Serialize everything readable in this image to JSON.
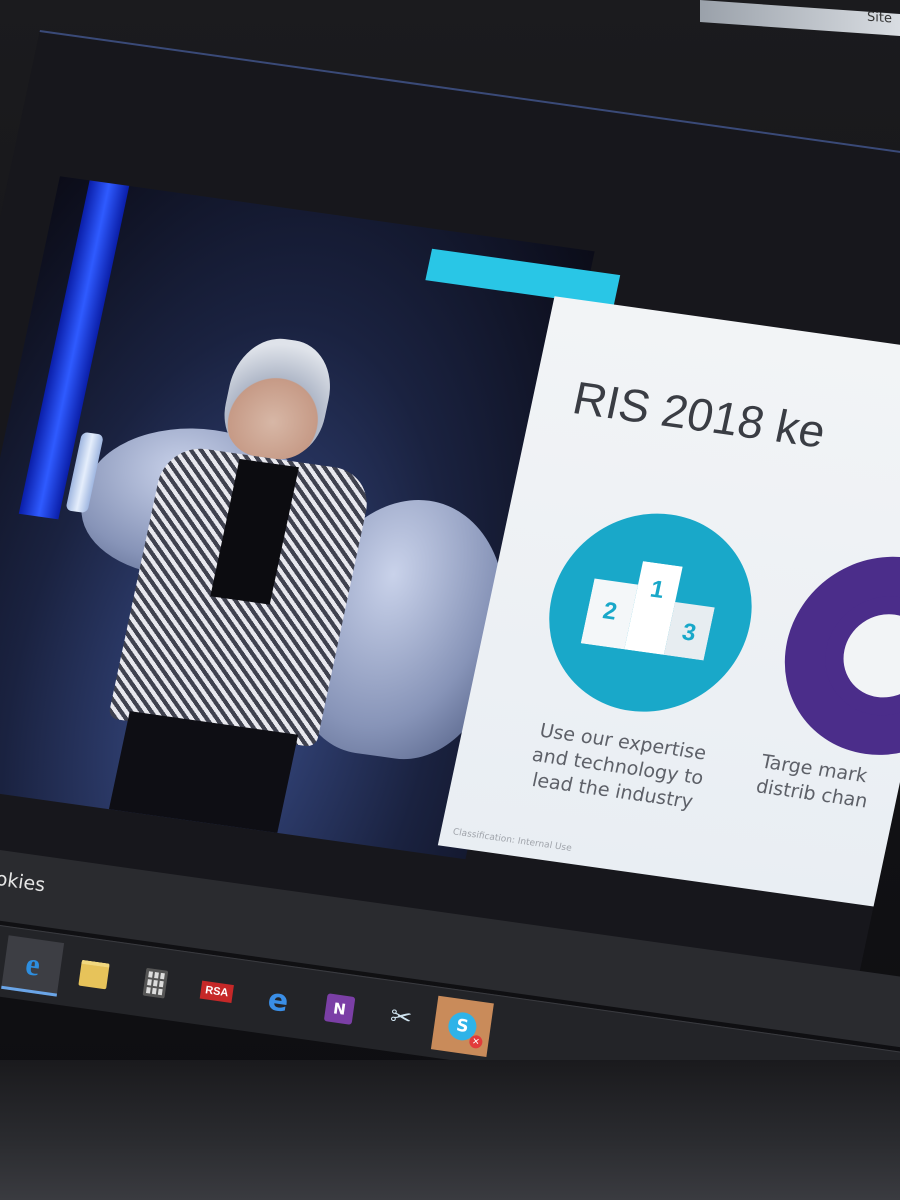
{
  "browser_strip": {
    "top_text": "Site",
    "cookie_text": "okies"
  },
  "slide": {
    "title": "RIS 2018 ke",
    "items": [
      {
        "caption": "Use our expertise and technology to lead the industry",
        "icon": "podium-icon"
      },
      {
        "caption": "Targe mark distrib chan",
        "icon": "target-icon"
      }
    ],
    "classification": "Classification: Internal Use",
    "podium_numbers": [
      "2",
      "1",
      "3"
    ]
  },
  "taskbar": {
    "apps": [
      {
        "name": "Internet Explorer",
        "icon": "ie-icon",
        "glyph": "e",
        "active": true
      },
      {
        "name": "File Explorer",
        "icon": "folder-icon"
      },
      {
        "name": "Calculator",
        "icon": "calculator-icon"
      },
      {
        "name": "RSA",
        "icon": "rsa-icon",
        "glyph": "RSA"
      },
      {
        "name": "Microsoft Edge",
        "icon": "edge-icon",
        "glyph": "e"
      },
      {
        "name": "OneNote",
        "icon": "onenote-icon",
        "glyph": "N"
      },
      {
        "name": "Snipping Tool",
        "icon": "snipping-tool-icon",
        "glyph": "✂"
      },
      {
        "name": "Skype for Business",
        "icon": "skype-icon",
        "glyph": "S",
        "badge": "✕"
      }
    ]
  },
  "colors": {
    "slide_accent_teal": "#19a8c9",
    "slide_accent_purple": "#4b2d8a",
    "cyan_bar": "#29c6e6",
    "stage_blue": "#2f5bff"
  }
}
